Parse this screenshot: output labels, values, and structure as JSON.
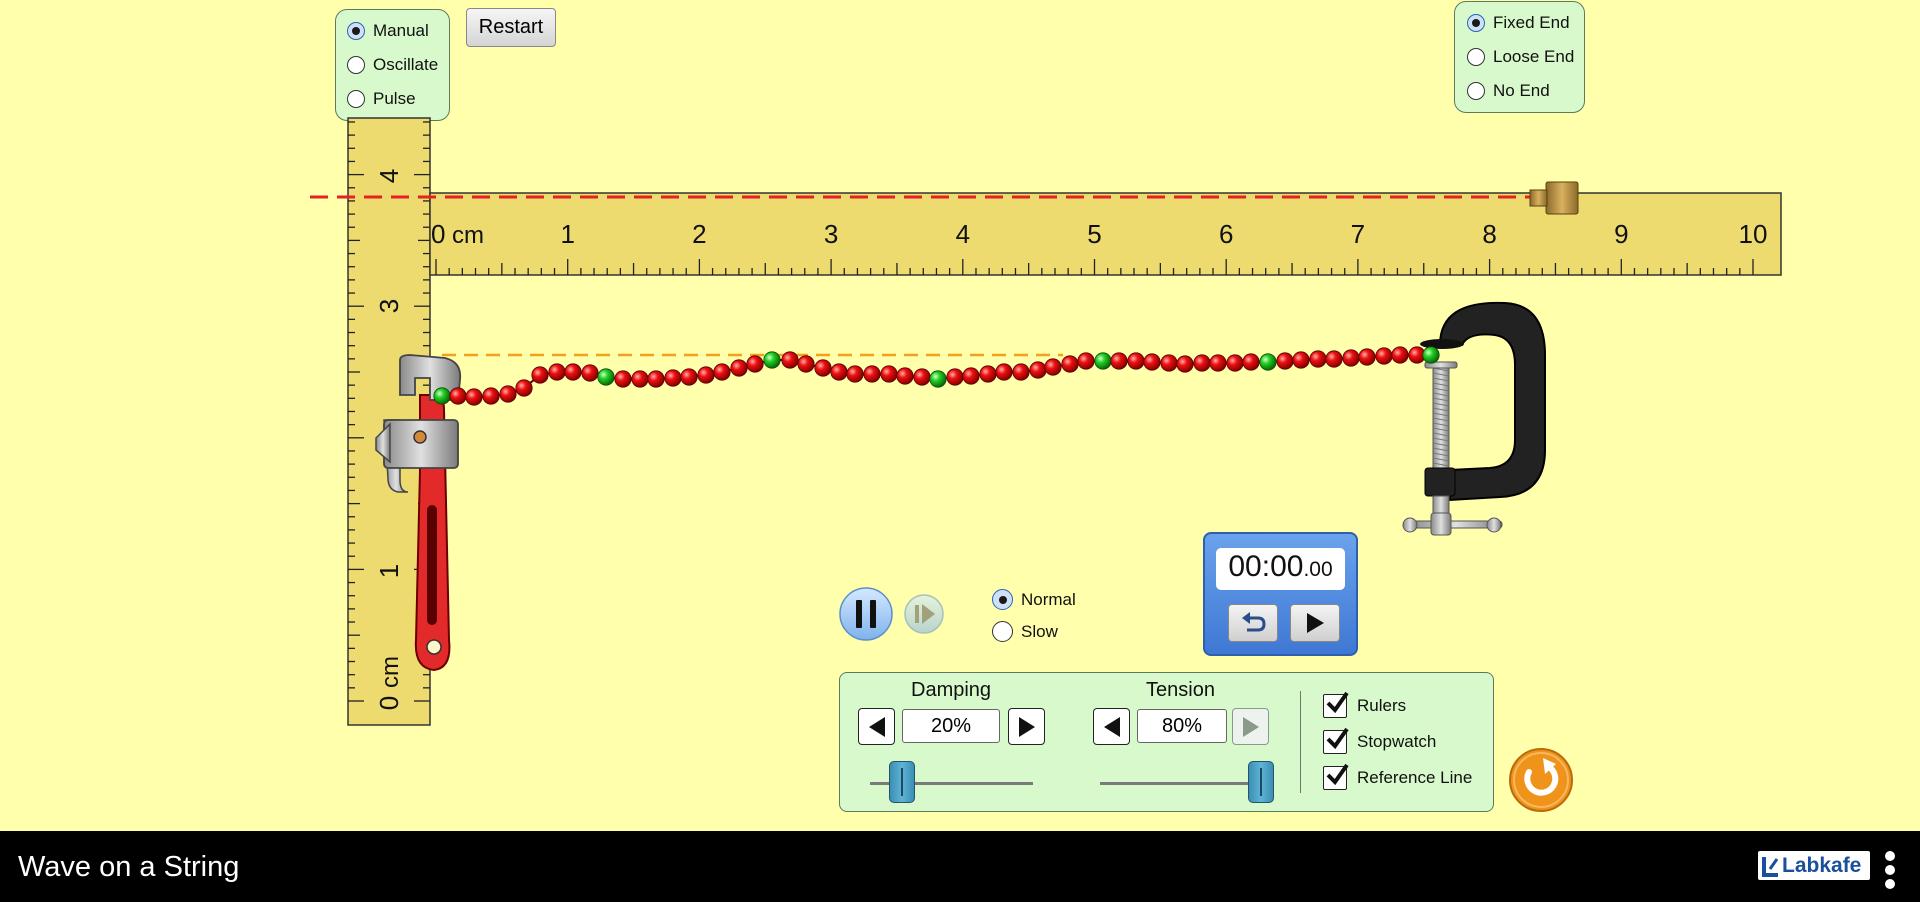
{
  "mode_options": [
    {
      "label": "Manual",
      "selected": true
    },
    {
      "label": "Oscillate",
      "selected": false
    },
    {
      "label": "Pulse",
      "selected": false
    }
  ],
  "restart_label": "Restart",
  "end_options": [
    {
      "label": "Fixed End",
      "selected": true
    },
    {
      "label": "Loose End",
      "selected": false
    },
    {
      "label": "No End",
      "selected": false
    }
  ],
  "horizontal_ruler": {
    "unit_label": "cm",
    "ticks": [
      "0",
      "1",
      "2",
      "3",
      "4",
      "5",
      "6",
      "7",
      "8",
      "9",
      "10"
    ]
  },
  "vertical_ruler": {
    "unit_label": "cm",
    "ticks": [
      "0",
      "1",
      "2",
      "3",
      "4"
    ]
  },
  "speed_options": [
    {
      "label": "Normal",
      "selected": true
    },
    {
      "label": "Slow",
      "selected": false
    }
  ],
  "stopwatch": {
    "main": "00:00",
    "fraction": ".00"
  },
  "controls": {
    "damping": {
      "label": "Damping",
      "value": "20%",
      "level": 0.2
    },
    "tension": {
      "label": "Tension",
      "value": "80%",
      "level": 1.0
    }
  },
  "checkboxes": [
    {
      "label": "Rulers",
      "checked": true
    },
    {
      "label": "Stopwatch",
      "checked": true
    },
    {
      "label": "Reference Line",
      "checked": true
    }
  ],
  "footer": {
    "title": "Wave on a String",
    "brand": "Labkafe"
  },
  "colors": {
    "background": "#ffffac",
    "panel": "#d8f9cc",
    "bead": "#e30000",
    "bead_marker": "#19c719",
    "ruler": "#eddb70",
    "reference_line": "#e52222",
    "stopwatch": "#4a86e0",
    "reset": "#f0931a"
  },
  "string_beads": {
    "count": 61,
    "marker_every": 10
  }
}
